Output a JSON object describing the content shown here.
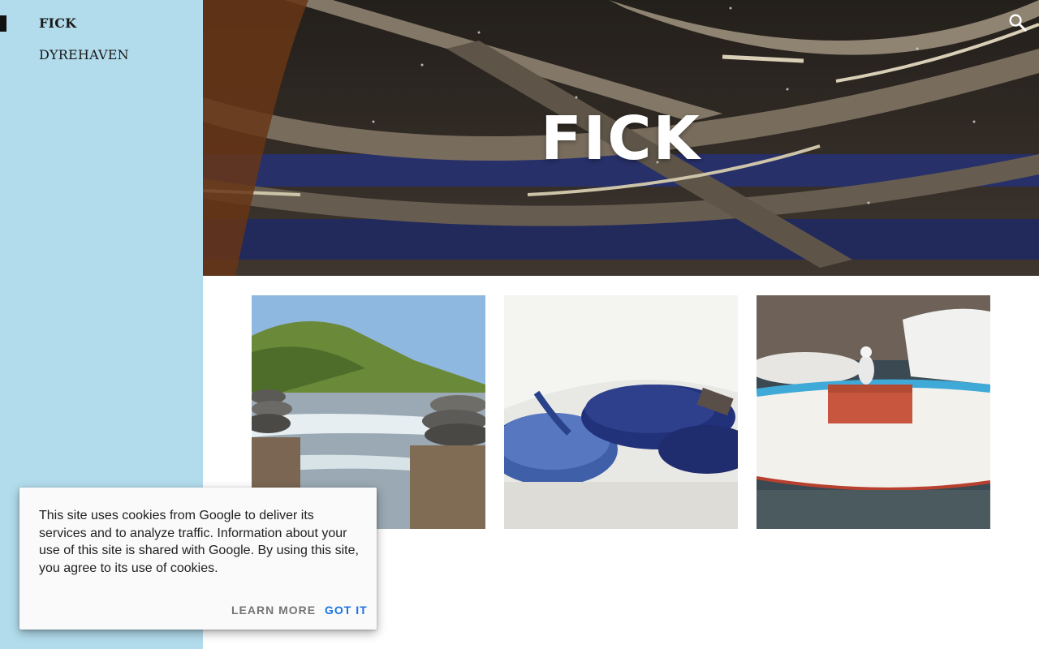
{
  "sidebar": {
    "items": [
      {
        "label": "FICK",
        "active": true
      },
      {
        "label": "DYREHAVEN",
        "active": false
      }
    ]
  },
  "hero": {
    "title": "FICK",
    "search_icon": "search-icon"
  },
  "gallery": {
    "photos": [
      {
        "subject": "beach-with-stacked-stones-photo"
      },
      {
        "subject": "flip-flops-in-sand-photo"
      },
      {
        "subject": "boats-with-seagull-photo"
      }
    ]
  },
  "cookie_banner": {
    "message": "This site uses cookies from Google to deliver its services and to analyze traffic. Information about your use of this site is shared with Google. By using this site, you agree to its use of cookies.",
    "learn_more_label": "LEARN MORE",
    "got_it_label": "GOT IT"
  },
  "colors": {
    "sidebar_bg": "#b2dcec",
    "accent_blue": "#1a73e8",
    "text_dark": "#212121"
  }
}
